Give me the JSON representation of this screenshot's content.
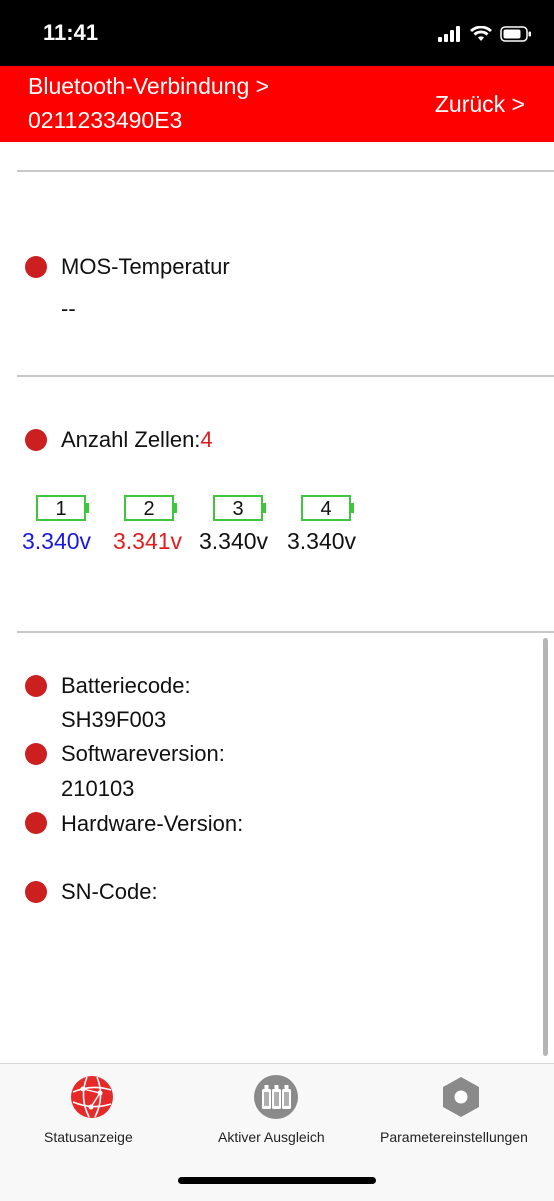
{
  "status_bar": {
    "time": "11:41"
  },
  "header": {
    "connection_label": "Bluetooth-Verbindung >",
    "device_id": "0211233490E3",
    "back_label": "Zurück >"
  },
  "mos": {
    "label": "MOS-Temperatur",
    "value": "--"
  },
  "cells": {
    "count_label": "Anzahl Zellen:",
    "count_value": "4",
    "items": [
      {
        "number": "1",
        "voltage": "3.340v",
        "color": "#1a1adf"
      },
      {
        "number": "2",
        "voltage": "3.341v",
        "color": "#e01e1e"
      },
      {
        "number": "3",
        "voltage": "3.340v",
        "color": "#111111"
      },
      {
        "number": "4",
        "voltage": "3.340v",
        "color": "#111111"
      }
    ],
    "battery_color": "#3ec63e"
  },
  "info": {
    "battery_code_label": "Batteriecode:",
    "battery_code_value": "SH39F003",
    "software_label": "Softwareversion:",
    "software_value": "210103",
    "hardware_label": "Hardware-Version:",
    "sn_label": "SN-Code:"
  },
  "tabs": [
    {
      "label": "Statusanzeige",
      "icon": "globe-network-icon"
    },
    {
      "label": "Aktiver Ausgleich",
      "icon": "battery-pack-icon"
    },
    {
      "label": "Parametereinstellungen",
      "icon": "settings-hexagon-icon"
    }
  ],
  "colors": {
    "accent": "#ff0000",
    "dot": "#cc1f1f",
    "count": "#e01e1e"
  }
}
